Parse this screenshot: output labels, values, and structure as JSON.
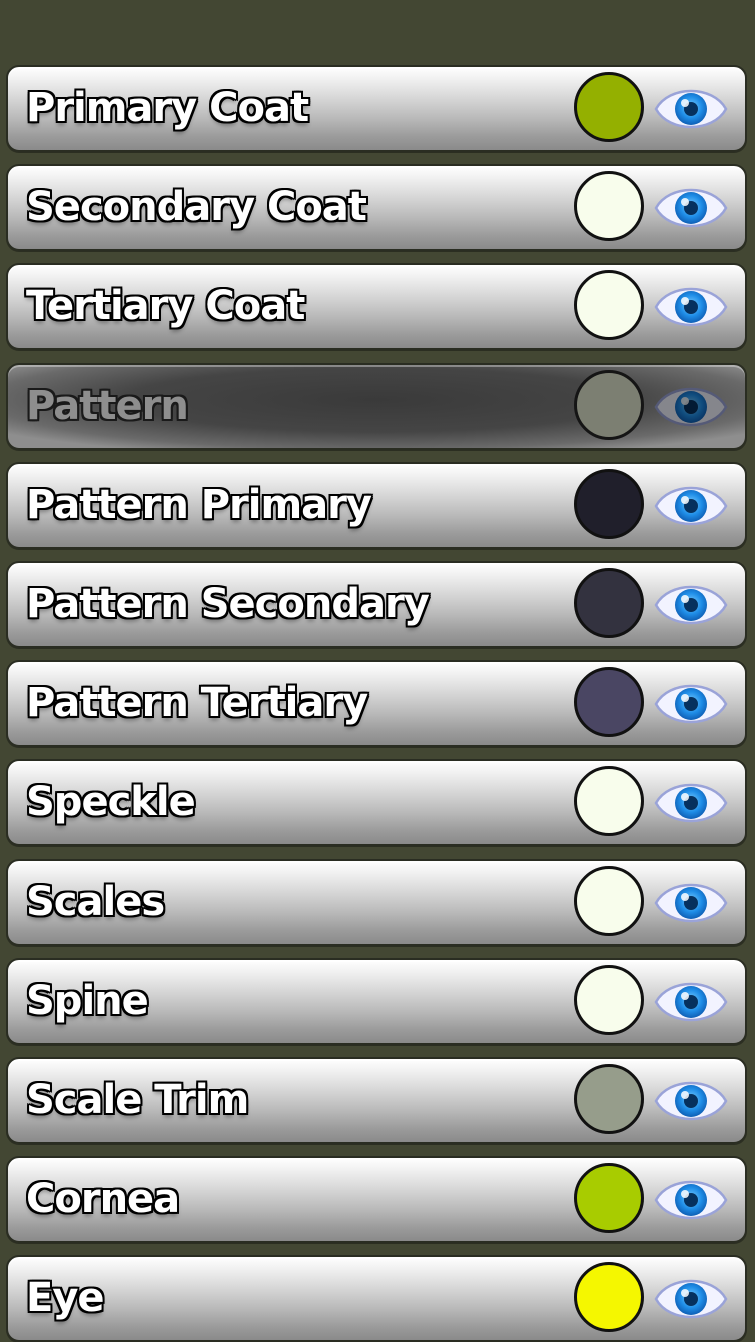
{
  "layers": [
    {
      "label": "Primary Coat",
      "color": "#94b000",
      "selected": false
    },
    {
      "label": "Secondary Coat",
      "color": "#f8fdec",
      "selected": false
    },
    {
      "label": "Tertiary Coat",
      "color": "#f8fdec",
      "selected": false
    },
    {
      "label": "Pattern",
      "color": "#c8cdb8",
      "selected": true
    },
    {
      "label": "Pattern Primary",
      "color": "#201f2b",
      "selected": false
    },
    {
      "label": "Pattern Secondary",
      "color": "#33323f",
      "selected": false
    },
    {
      "label": "Pattern Tertiary",
      "color": "#4a4663",
      "selected": false
    },
    {
      "label": "Speckle",
      "color": "#f8fdec",
      "selected": false
    },
    {
      "label": "Scales",
      "color": "#f8fdec",
      "selected": false
    },
    {
      "label": "Spine",
      "color": "#f8fdec",
      "selected": false
    },
    {
      "label": "Scale Trim",
      "color": "#969d8b",
      "selected": false
    },
    {
      "label": "Cornea",
      "color": "#a8cc00",
      "selected": false
    },
    {
      "label": "Eye",
      "color": "#f5f700",
      "selected": false
    }
  ],
  "visibility_icon": "eye-icon"
}
